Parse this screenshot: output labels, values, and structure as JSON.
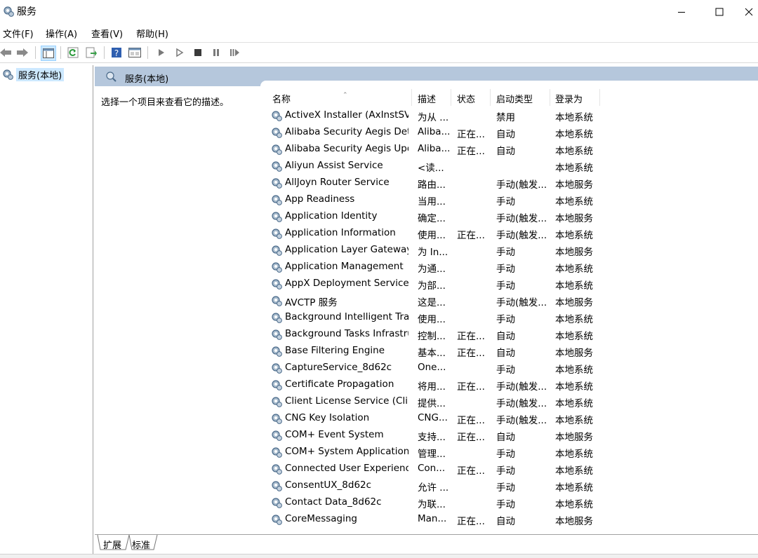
{
  "window": {
    "title": "服务"
  },
  "menu": [
    "文件(F)",
    "操作(A)",
    "查看(V)",
    "帮助(H)"
  ],
  "tree": {
    "selected": "服务(本地)"
  },
  "panel": {
    "title": "服务(本地)",
    "description": "选择一个项目来查看它的描述。"
  },
  "columns": [
    "名称",
    "描述",
    "状态",
    "启动类型",
    "登录为"
  ],
  "services": [
    {
      "name": "ActiveX Installer (AxInstSV)",
      "desc": "为从 ...",
      "status": "",
      "startup": "禁用",
      "logon": "本地系统"
    },
    {
      "name": "Alibaba Security Aegis Det...",
      "desc": "Aliba...",
      "status": "正在...",
      "startup": "自动",
      "logon": "本地系统"
    },
    {
      "name": "Alibaba Security Aegis Upd...",
      "desc": "Aliba...",
      "status": "正在...",
      "startup": "自动",
      "logon": "本地系统"
    },
    {
      "name": "Aliyun Assist Service",
      "desc": "<读...",
      "status": "",
      "startup": "",
      "logon": "本地系统"
    },
    {
      "name": "AllJoyn Router Service",
      "desc": "路由...",
      "status": "",
      "startup": "手动(触发...",
      "logon": "本地服务"
    },
    {
      "name": "App Readiness",
      "desc": "当用...",
      "status": "",
      "startup": "手动",
      "logon": "本地系统"
    },
    {
      "name": "Application Identity",
      "desc": "确定...",
      "status": "",
      "startup": "手动(触发...",
      "logon": "本地服务"
    },
    {
      "name": "Application Information",
      "desc": "使用...",
      "status": "正在...",
      "startup": "手动(触发...",
      "logon": "本地系统"
    },
    {
      "name": "Application Layer Gateway ...",
      "desc": "为 In...",
      "status": "",
      "startup": "手动",
      "logon": "本地服务"
    },
    {
      "name": "Application Management",
      "desc": "为通...",
      "status": "",
      "startup": "手动",
      "logon": "本地系统"
    },
    {
      "name": "AppX Deployment Service ...",
      "desc": "为部...",
      "status": "",
      "startup": "手动",
      "logon": "本地系统"
    },
    {
      "name": "AVCTP 服务",
      "desc": "这是...",
      "status": "",
      "startup": "手动(触发...",
      "logon": "本地服务"
    },
    {
      "name": "Background Intelligent Tra...",
      "desc": "使用...",
      "status": "",
      "startup": "手动",
      "logon": "本地系统"
    },
    {
      "name": "Background Tasks Infrastru...",
      "desc": "控制...",
      "status": "正在...",
      "startup": "自动",
      "logon": "本地系统"
    },
    {
      "name": "Base Filtering Engine",
      "desc": "基本...",
      "status": "正在...",
      "startup": "自动",
      "logon": "本地服务"
    },
    {
      "name": "CaptureService_8d62c",
      "desc": "One...",
      "status": "",
      "startup": "手动",
      "logon": "本地系统"
    },
    {
      "name": "Certificate Propagation",
      "desc": "将用...",
      "status": "正在...",
      "startup": "手动(触发...",
      "logon": "本地系统"
    },
    {
      "name": "Client License Service (Clip...",
      "desc": "提供...",
      "status": "",
      "startup": "手动(触发...",
      "logon": "本地系统"
    },
    {
      "name": "CNG Key Isolation",
      "desc": "CNG...",
      "status": "正在...",
      "startup": "手动(触发...",
      "logon": "本地系统"
    },
    {
      "name": "COM+ Event System",
      "desc": "支持...",
      "status": "正在...",
      "startup": "自动",
      "logon": "本地服务"
    },
    {
      "name": "COM+ System Application",
      "desc": "管理...",
      "status": "",
      "startup": "手动",
      "logon": "本地系统"
    },
    {
      "name": "Connected User Experienc...",
      "desc": "Con...",
      "status": "正在...",
      "startup": "手动",
      "logon": "本地系统"
    },
    {
      "name": "ConsentUX_8d62c",
      "desc": "允许 ...",
      "status": "",
      "startup": "手动",
      "logon": "本地系统"
    },
    {
      "name": "Contact Data_8d62c",
      "desc": "为联...",
      "status": "",
      "startup": "手动",
      "logon": "本地系统"
    },
    {
      "name": "CoreMessaging",
      "desc": "Man...",
      "status": "正在...",
      "startup": "自动",
      "logon": "本地服务"
    }
  ],
  "bottom_tabs": [
    "扩展",
    "标准"
  ]
}
